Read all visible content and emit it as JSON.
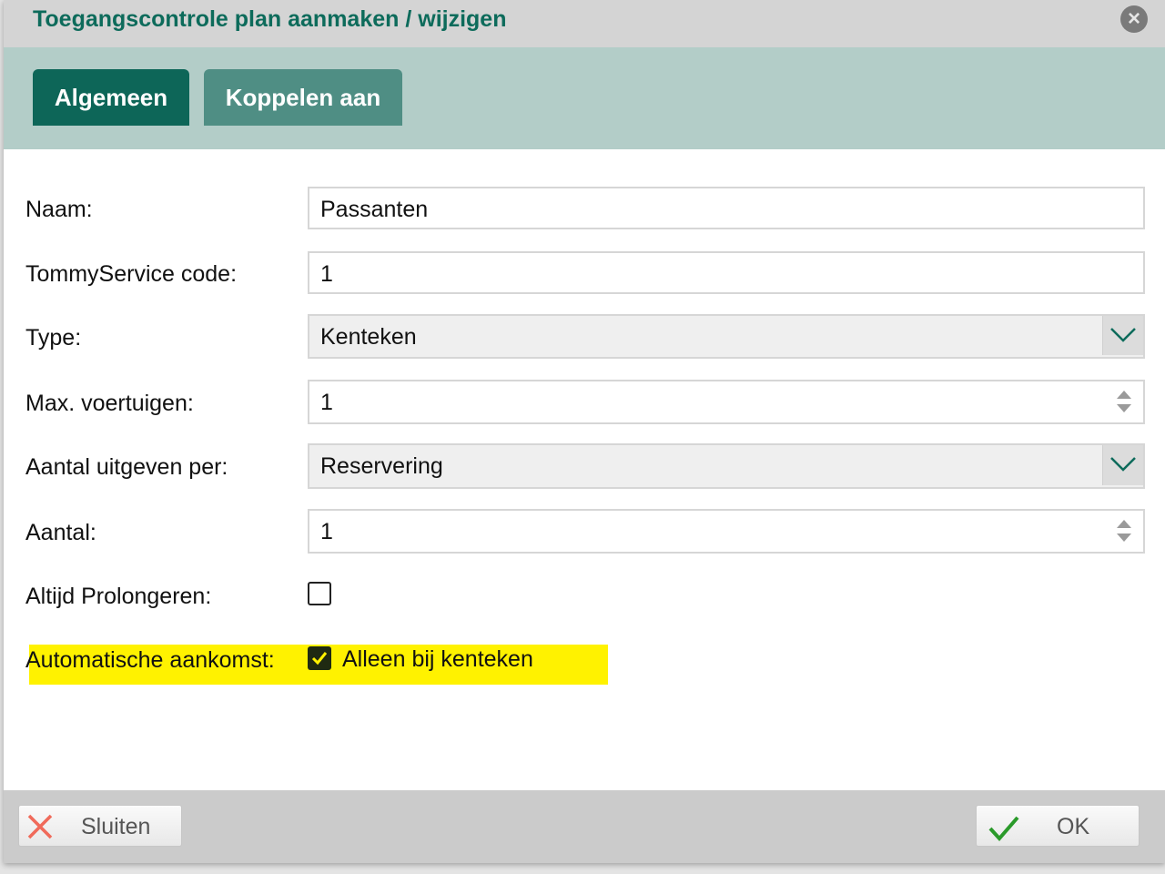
{
  "dialog": {
    "title": "Toegangscontrole plan aanmaken / wijzigen",
    "close_symbol": "×"
  },
  "tabs": [
    {
      "label": "Algemeen",
      "active": true
    },
    {
      "label": "Koppelen aan",
      "active": false
    }
  ],
  "form": {
    "naam": {
      "label": "Naam:",
      "value": "Passanten"
    },
    "tommyservice_code": {
      "label": "TommyService code:",
      "value": "1"
    },
    "type": {
      "label": "Type:",
      "value": "Kenteken"
    },
    "max_voertuigen": {
      "label": "Max. voertuigen:",
      "value": "1"
    },
    "aantal_uitgeven_per": {
      "label": "Aantal uitgeven per:",
      "value": "Reservering"
    },
    "aantal": {
      "label": "Aantal:",
      "value": "1"
    },
    "altijd_prolongeren": {
      "label": "Altijd Prolongeren:",
      "checked": false
    },
    "automatische_aankomst": {
      "label": "Automatische aankomst:",
      "checkbox_label": "Alleen bij kenteken",
      "checked": true
    }
  },
  "footer": {
    "close_label": "Sluiten",
    "ok_label": "OK"
  },
  "icons": {
    "close": "close-x-icon",
    "dropdown": "chevron-down-icon",
    "spinner": "spinner-arrows-icon",
    "check": "checkmark-icon"
  },
  "colors": {
    "title": "#0d6b5b",
    "tabbar_bg": "#b3cdc8",
    "tab_active": "#0d6658",
    "tab_inactive": "#4f8e84",
    "highlight": "#fff200",
    "cancel_icon": "#f06a5a",
    "ok_icon": "#2a9a2a"
  }
}
